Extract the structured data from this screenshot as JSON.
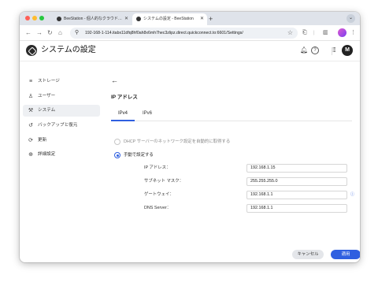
{
  "browser": {
    "tabs": [
      {
        "title": "BeeStation - 個人的なクラウド…",
        "active": false
      },
      {
        "title": "システムの設定 - BeeStation",
        "active": true
      }
    ],
    "new_tab": "+",
    "tab_menu": "⌄",
    "url": "192-168-1-114.itabx11dfq8hf0ah8x6mh7hec3zlipz.direct.quickconnect.to:6601/Settings/"
  },
  "header": {
    "title": "システムの設定",
    "avatar_initial": "M"
  },
  "sidebar": {
    "items": [
      {
        "label": "ストレージ",
        "icon": "≡"
      },
      {
        "label": "ユーザー",
        "icon": "♙"
      },
      {
        "label": "システム",
        "icon": "⚒"
      },
      {
        "label": "バックアップと復元",
        "icon": "↺"
      },
      {
        "label": "更新",
        "icon": "⟳"
      },
      {
        "label": "詳細設定",
        "icon": "⊕"
      }
    ],
    "active_index": 2
  },
  "main": {
    "back": "←",
    "section_title": "IP アドレス",
    "tabs": [
      "IPv4",
      "IPv6"
    ],
    "selected_tab": "IPv4",
    "options": {
      "dhcp": "DHCP サーバーのネットワーク設定を自動的に取得する",
      "manual": "手動で設定する"
    },
    "selected_option": "manual",
    "fields": {
      "ip_label": "IP アドレス：",
      "ip_value": "192.168.1.15",
      "subnet_label": "サブネット マスク：",
      "subnet_value": "255.255.255.0",
      "gateway_label": "ゲートウェイ：",
      "gateway_value": "192.168.1.1",
      "dns_label": "DNS Server：",
      "dns_value": "192.168.1.1"
    },
    "cancel_label": "キャンセル",
    "apply_label": "適用"
  },
  "colors": {
    "accent": "#2f5fe0",
    "window_close": "#ff5f57",
    "window_minimize": "#febc2e",
    "window_zoom": "#28c840"
  }
}
